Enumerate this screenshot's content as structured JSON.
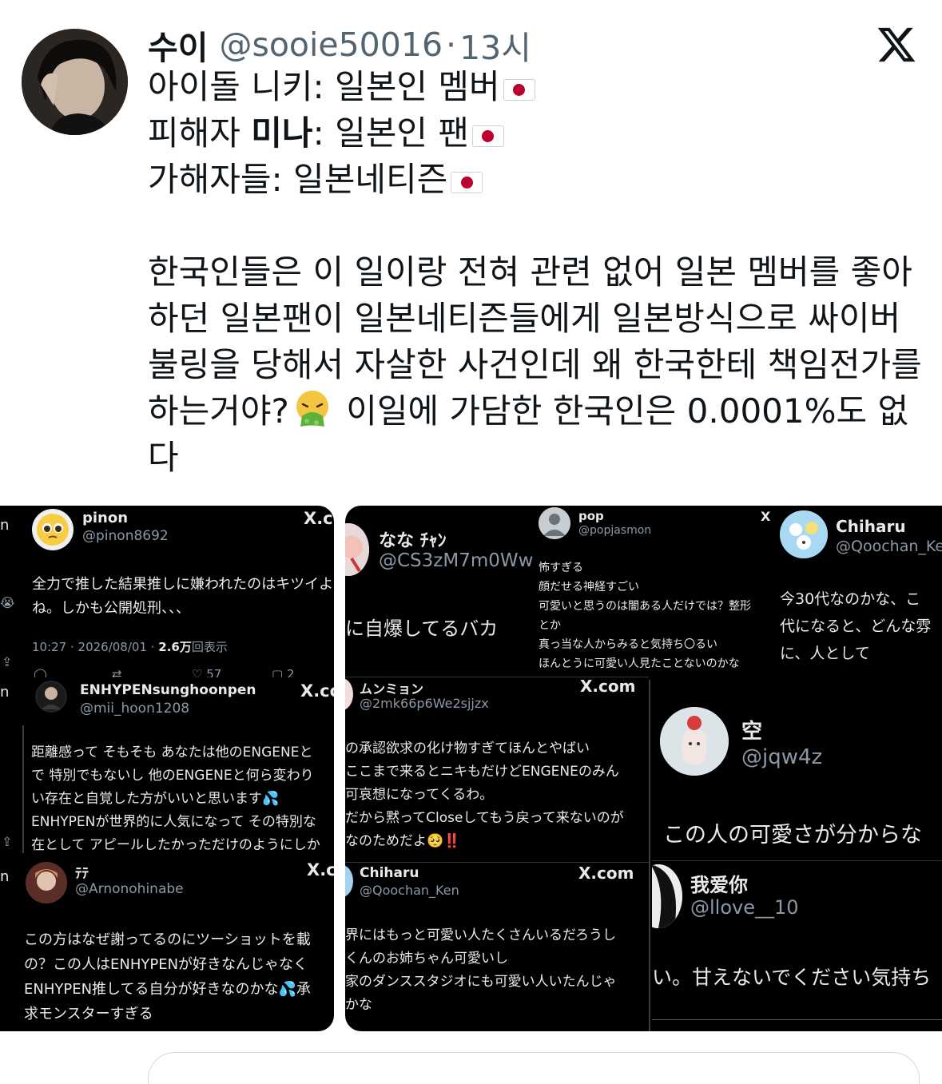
{
  "tweet": {
    "display_name": "수이",
    "handle": "@sooie50016",
    "separator": "·",
    "time": "13시",
    "lines": [
      "아이돌 니키: 일본인 멤버",
      "피해자 ",
      "미나",
      ": 일본인 팬",
      "가해자들: 일본네티즌"
    ],
    "paragraph_before": "한국인들은 이 일이랑 전혀 관련 없어 일본 멤버를 좋아하던 일본팬이 일본네티즌들에게 일본방식으로 싸이버불링을 당해서 자살한 사건인데 왜 한국한테 책임전가를 하는거야?",
    "paragraph_after": " 이일에 가담한 한국인은 0.0001%도 없다",
    "icons": [
      "x-logo-icon",
      "japan-flag-icon",
      "vomiting-face-icon"
    ]
  },
  "media": {
    "left": [
      {
        "name": "pinon",
        "handle": "@pinon8692",
        "site": "X.c",
        "text": [
          "全力で推した結果推しに嫌われたのはキツイよ",
          "ね。しかも公開処刑、、、"
        ],
        "time": "10:27 · 2026/08/01 · ",
        "views": "2.6万",
        "views_label": "回表示",
        "likes": "57",
        "bookmarks": "2"
      },
      {
        "name": "ENHYPENsunghoonpen",
        "handle": "@mii_hoon1208",
        "site": "X.co",
        "text": [
          "距離感って そもそも あなたは他のENGENEと",
          "で 特別でもないし 他のENGENEと何ら変わり",
          "い存在と自覚した方がいいと思います💦",
          "ENHYPENが世界的に人気になって その特別な",
          "在として アピールしたかっただけのようにしか"
        ]
      },
      {
        "name": "ﾃﾃ",
        "handle": "@Arnonohinabe",
        "site": "X.c",
        "text": [
          "この方はなぜ謝ってるのにツーショットを載",
          "の？この人はENHYPENが好きなんじゃなく",
          "ENHYPEN推してる自分が好きなのかな💦承",
          "求モンスターすぎる"
        ]
      }
    ],
    "right": [
      {
        "name": "なな ﾁｬﾝ",
        "handle": "@CS3zM7m0Ww",
        "text": [
          "に自爆してるバカ"
        ]
      },
      {
        "name": "pop",
        "handle": "@popjasmon",
        "site": "X",
        "text": [
          "怖すぎる",
          "顔だせる神経すごい",
          "可愛いと思うのは闇ある人だけでは？整形",
          "とか",
          "真っ当な人からみると気持ち〇るい",
          "ほんとうに可愛い人見たことないのかな"
        ]
      },
      {
        "name": "Chiharu",
        "handle": "@Qoochan_Ke",
        "text": [
          "今30代なのかな、こ",
          "代になると、どんな雰",
          "に、人として"
        ]
      },
      {
        "name": "ムンミョン",
        "handle": "@2mk66p6We2sjjzx",
        "site": "X.com",
        "text": [
          "の承認欲求の化け物すぎてほんとやばい",
          "ここまで来るとニキもだけどENGENEのみん",
          "可哀想になってくるわ。",
          "だから黙ってCloseしてもう戻って来ないのが",
          "なのためだよ🥺‼️"
        ]
      },
      {
        "name": "空",
        "handle": "@jqw4z",
        "text": [
          "この人の可愛さが分からな"
        ]
      },
      {
        "name": "Chiharu",
        "handle": "@Qoochan_Ken",
        "site": "X.com",
        "text": [
          "界にはもっと可愛い人たくさんいるだろうし",
          "くんのお姉ちゃん可愛いし",
          "家のダンススタジオにも可愛い人いたんじゃ",
          "かな"
        ]
      },
      {
        "name": "我爱你",
        "handle": "@llove__10",
        "text": [
          "い。甘えないでください気持ち"
        ]
      }
    ]
  },
  "colors": {
    "text": "#0f1419",
    "muted": "#536471",
    "dark_bg": "#000000",
    "dark_text": "#e7e9ea",
    "dark_muted": "#8b98a5"
  }
}
